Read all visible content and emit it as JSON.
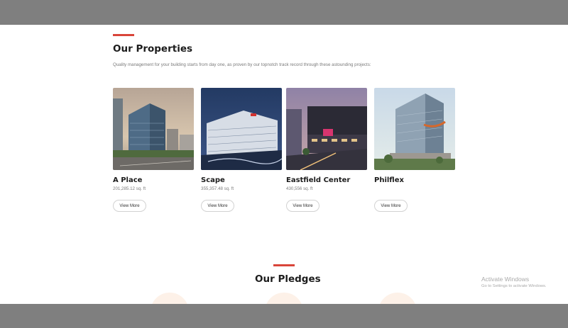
{
  "properties_section": {
    "title": "Our Properties",
    "intro": "Quality management for your building starts from day one, as proven by our topnotch track record through these astounding projects:",
    "accent_color": "#d9453a",
    "cards": [
      {
        "name": "A Place",
        "area": "201,285.12 sq. ft",
        "button": "View More",
        "image": "a-place-tower-photo"
      },
      {
        "name": "Scape",
        "area": "355,357.48 sq. ft",
        "button": "View More",
        "image": "scape-building-photo"
      },
      {
        "name": "Eastfield Center",
        "area": "430,556 sq. ft",
        "button": "View More",
        "image": "eastfield-center-photo"
      },
      {
        "name": "Philflex",
        "area": "",
        "button": "View More",
        "image": "philflex-building-photo"
      }
    ]
  },
  "pledges_section": {
    "title": "Our Pledges",
    "circle_color": "#fdf1e8"
  },
  "watermark": {
    "title": "Activate Windows",
    "subtitle": "Go to Settings to activate Windows."
  }
}
